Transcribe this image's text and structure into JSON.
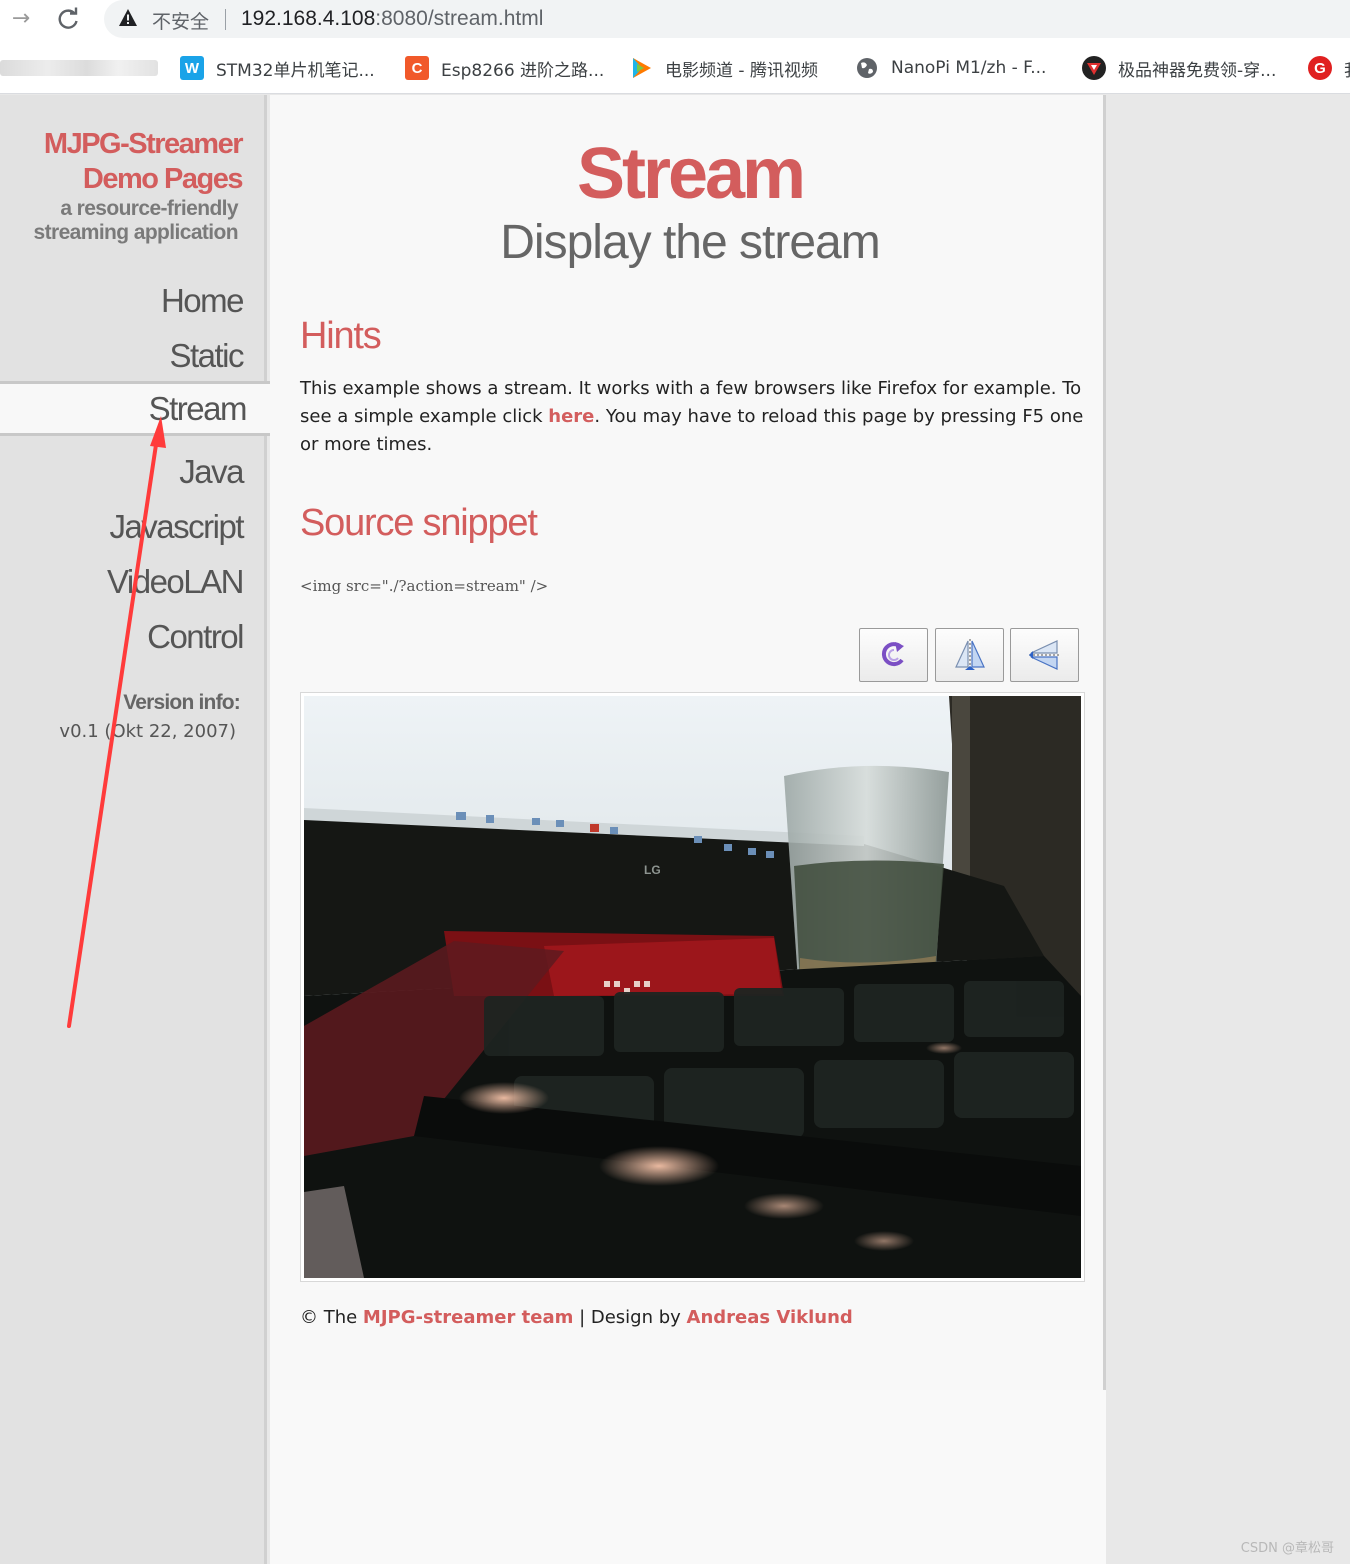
{
  "browser": {
    "insecure_label": "不安全",
    "url_host": "192.168.4.108",
    "url_rest": ":8080/stream.html",
    "bookmarks": [
      {
        "label": "STM32单片机笔记...",
        "icon": "waveshare-icon",
        "color": "#1aa3e8"
      },
      {
        "label": "Esp8266 进阶之路...",
        "icon": "csdn-icon",
        "color": "#f1592a"
      },
      {
        "label": "电影频道 - 腾讯视频",
        "icon": "tencent-video-icon",
        "color": "#ff7a00"
      },
      {
        "label": "NanoPi M1/zh - F...",
        "icon": "globe-icon",
        "color": "#5f6368"
      },
      {
        "label": "极品神器免费领-穿...",
        "icon": "game-icon",
        "color": "#333333"
      },
      {
        "label": "我",
        "icon": "g-icon",
        "color": "#e02020"
      }
    ]
  },
  "sidebar": {
    "logo_line1": "MJPG-Streamer",
    "logo_line2": "Demo Pages",
    "tagline_line1": "a resource-friendly",
    "tagline_line2": "streaming application",
    "menu": [
      {
        "label": "Home",
        "active": false
      },
      {
        "label": "Static",
        "active": false
      },
      {
        "label": "Stream",
        "active": true
      },
      {
        "label": "Java",
        "active": false
      },
      {
        "label": "Javascript",
        "active": false
      },
      {
        "label": "VideoLAN",
        "active": false
      },
      {
        "label": "Control",
        "active": false
      }
    ],
    "version_label": "Version info:",
    "version_value": "v0.1 (Okt 22, 2007)"
  },
  "main": {
    "title": "Stream",
    "subtitle": "Display the stream",
    "hints_heading": "Hints",
    "hints_text_1": "This example shows a stream. It works with a few browsers like Firefox for example. To see a simple example click ",
    "hints_link": "here",
    "hints_text_2": ". You may have to reload this page by pressing F5 one or more times.",
    "source_heading": "Source snippet",
    "source_code": "<img src=\"./?action=stream\" />",
    "controls": [
      {
        "name": "rotate-button",
        "icon": "rotate-icon"
      },
      {
        "name": "flip-vertical-button",
        "icon": "flip-vertical-icon"
      },
      {
        "name": "flip-horizontal-button",
        "icon": "flip-horizontal-icon"
      }
    ]
  },
  "footer": {
    "prefix": "© The ",
    "team_link": "MJPG-streamer team",
    "middle": " | Design by ",
    "designer_link": "Andreas Viklund"
  },
  "watermark": "CSDN @章松哥",
  "colors": {
    "accent": "#d35d5d",
    "annotation_arrow": "#ff3b3b"
  }
}
